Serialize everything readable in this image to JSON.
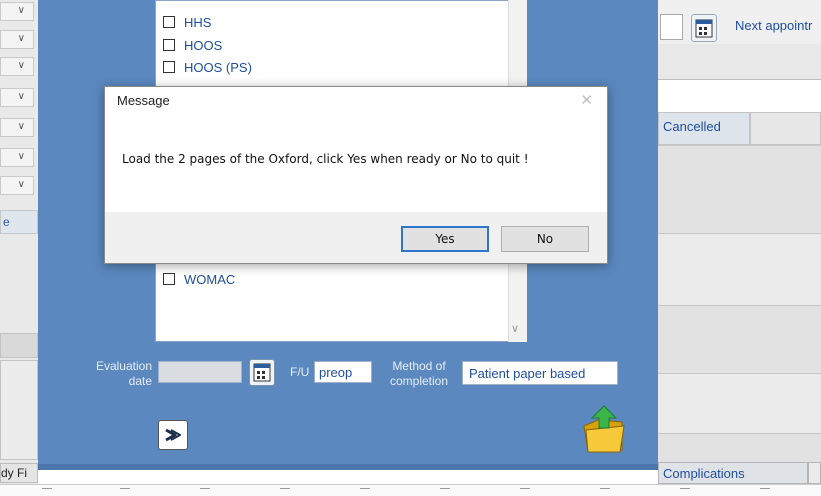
{
  "left_strip": {
    "dropdown_count": 7,
    "partial_label": "e",
    "bottom_label": "dy Fi"
  },
  "right_panel": {
    "next_appointment_label": "Next appointr",
    "cancelled_label": "Cancelled",
    "complications_label": "Complications"
  },
  "form": {
    "checklist": [
      {
        "label": "HHS",
        "checked": false
      },
      {
        "label": "HOOS",
        "checked": false
      },
      {
        "label": "HOOS (PS)",
        "checked": false
      },
      {
        "label": "WOMAC",
        "checked": false
      }
    ],
    "evaluation_date_label": "Evaluation date",
    "evaluation_date_value": "",
    "fu_label": "F/U",
    "fu_value": "preop",
    "method_label": "Method of completion",
    "method_value": "Patient paper based"
  },
  "dialog": {
    "title": "Message",
    "message": "Load the 2 pages of the Oxford, click Yes when ready or No to quit !",
    "yes_label": "Yes",
    "no_label": "No"
  },
  "colors": {
    "form_bg": "#5a88bf",
    "link_blue": "#1f4e9e",
    "accent_focus": "#2f75c9"
  }
}
